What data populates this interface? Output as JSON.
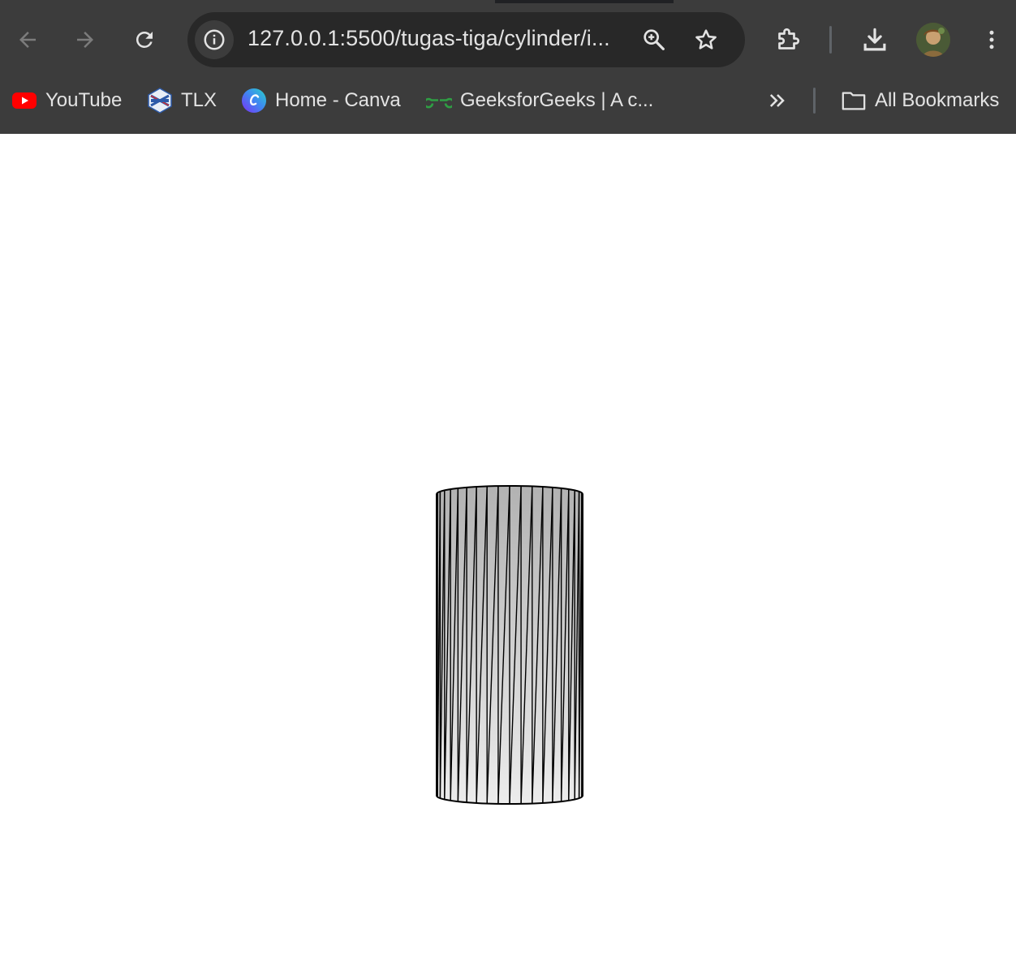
{
  "browser": {
    "url_host": "127.0.0.1",
    "url_rest": ":5500/tugas-tiga/cylinder/i...",
    "icons": {
      "back": "arrow-left",
      "forward": "arrow-right",
      "reload": "reload",
      "site_info": "info",
      "zoom": "zoom-in",
      "bookmark_star": "star",
      "extensions": "puzzle",
      "downloads": "download",
      "menu": "kebab-menu"
    }
  },
  "bookmarks": {
    "items": [
      {
        "label": "YouTube",
        "icon": "youtube-icon"
      },
      {
        "label": "TLX",
        "icon": "tlx-icon"
      },
      {
        "label": "Home - Canva",
        "icon": "canva-icon"
      },
      {
        "label": "GeeksforGeeks | A c...",
        "icon": "geeksforgeeks-icon"
      }
    ],
    "overflow_icon": "chevrons-right",
    "all_bookmarks_label": "All Bookmarks"
  },
  "scene": {
    "object": "cylinder",
    "rendering": "wireframe triangles with vertical gradient shading",
    "segments": 20,
    "colors": {
      "background": "#ffffff",
      "shade_top": "#b2b2b2",
      "shade_bottom": "#ececec",
      "edge": "#000000"
    }
  }
}
